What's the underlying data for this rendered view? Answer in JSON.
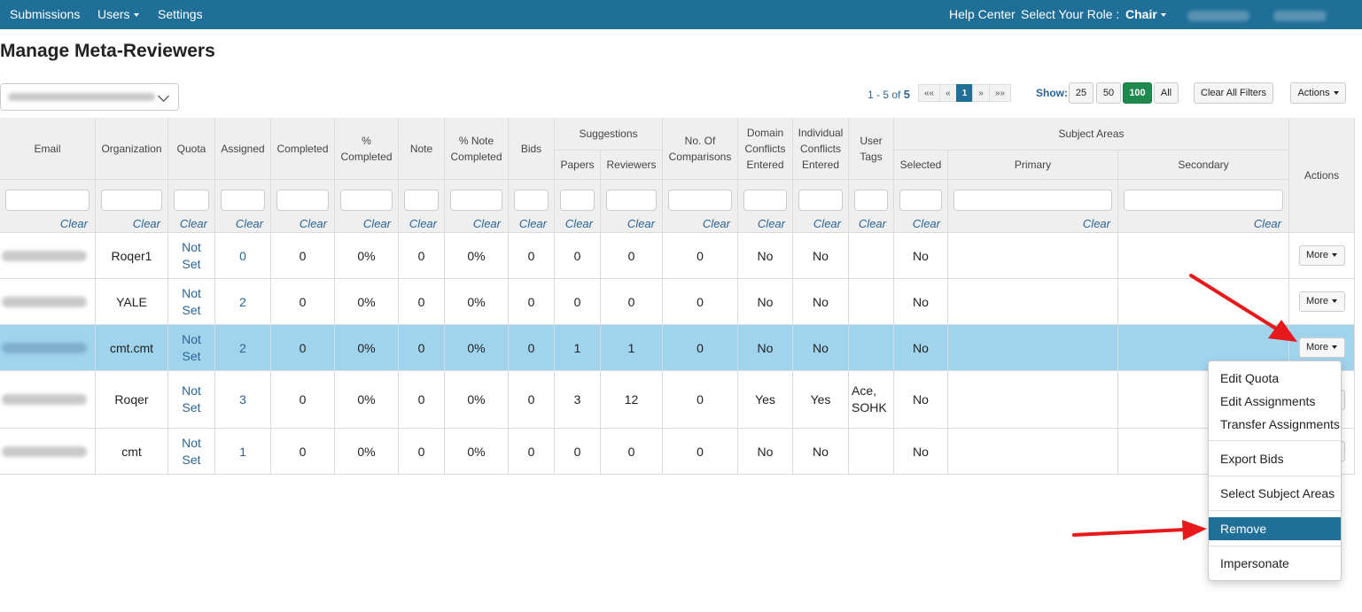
{
  "nav": {
    "submissions": "Submissions",
    "users": "Users",
    "settings": "Settings",
    "help_center": "Help Center",
    "select_role_label": "Select Your Role :",
    "role": "Chair"
  },
  "page": {
    "title": "Manage Meta-Reviewers"
  },
  "pagination": {
    "range_prefix": "1 - 5 of",
    "total": "5",
    "first": "««",
    "prev": "«",
    "current": "1",
    "next": "»",
    "last": "»»"
  },
  "show": {
    "label": "Show:",
    "options": [
      "25",
      "50",
      "100",
      "All"
    ],
    "selected": "100"
  },
  "toolbar": {
    "clear_filters": "Clear All Filters",
    "actions": "Actions"
  },
  "table": {
    "headers": {
      "email": "Email",
      "organization": "Organization",
      "quota": "Quota",
      "assigned": "Assigned",
      "completed": "Completed",
      "pct_completed": "% Completed",
      "note": "Note",
      "pct_note_completed": "% Note Completed",
      "bids": "Bids",
      "suggestions": "Suggestions",
      "papers": "Papers",
      "reviewers": "Reviewers",
      "num_comparisons": "No. Of Comparisons",
      "domain_conflicts": "Domain Conflicts Entered",
      "individual_conflicts": "Individual Conflicts Entered",
      "user_tags": "User Tags",
      "subject_areas": "Subject Areas",
      "selected": "Selected",
      "primary": "Primary",
      "secondary": "Secondary",
      "actions": "Actions"
    },
    "clear_label": "Clear",
    "more_label": "More",
    "rows": [
      {
        "org": "Roqer1",
        "quota": "Not Set",
        "assigned": "0",
        "completed": "0",
        "pct": "0%",
        "note": "0",
        "pct_note": "0%",
        "bids": "0",
        "papers": "0",
        "reviewers": "0",
        "comparisons": "0",
        "domain": "No",
        "individual": "No",
        "tags": "",
        "selected": "No"
      },
      {
        "org": "YALE",
        "quota": "Not Set",
        "assigned": "2",
        "completed": "0",
        "pct": "0%",
        "note": "0",
        "pct_note": "0%",
        "bids": "0",
        "papers": "0",
        "reviewers": "0",
        "comparisons": "0",
        "domain": "No",
        "individual": "No",
        "tags": "",
        "selected": "No"
      },
      {
        "org": "cmt.cmt",
        "quota": "Not Set",
        "assigned": "2",
        "completed": "0",
        "pct": "0%",
        "note": "0",
        "pct_note": "0%",
        "bids": "0",
        "papers": "1",
        "reviewers": "1",
        "comparisons": "0",
        "domain": "No",
        "individual": "No",
        "tags": "",
        "selected": "No"
      },
      {
        "org": "Roqer",
        "quota": "Not Set",
        "assigned": "3",
        "completed": "0",
        "pct": "0%",
        "note": "0",
        "pct_note": "0%",
        "bids": "0",
        "papers": "3",
        "reviewers": "12",
        "comparisons": "0",
        "domain": "Yes",
        "individual": "Yes",
        "tags": "Ace, SOHK",
        "selected": "No"
      },
      {
        "org": "cmt",
        "quota": "Not Set",
        "assigned": "1",
        "completed": "0",
        "pct": "0%",
        "note": "0",
        "pct_note": "0%",
        "bids": "0",
        "papers": "0",
        "reviewers": "0",
        "comparisons": "0",
        "domain": "No",
        "individual": "No",
        "tags": "",
        "selected": "No"
      }
    ]
  },
  "more_menu": {
    "items": [
      "Edit Quota",
      "Edit Assignments",
      "Transfer Assignments",
      "Export Bids",
      "Select Subject Areas",
      "Remove",
      "Impersonate"
    ],
    "highlighted": "Remove"
  },
  "colors": {
    "nav_bg": "#1f6f99",
    "row_highlight": "#a0d4ed",
    "link": "#2a6496",
    "active_green": "#1e8a4e",
    "annotation_arrow": "#e8191b"
  }
}
